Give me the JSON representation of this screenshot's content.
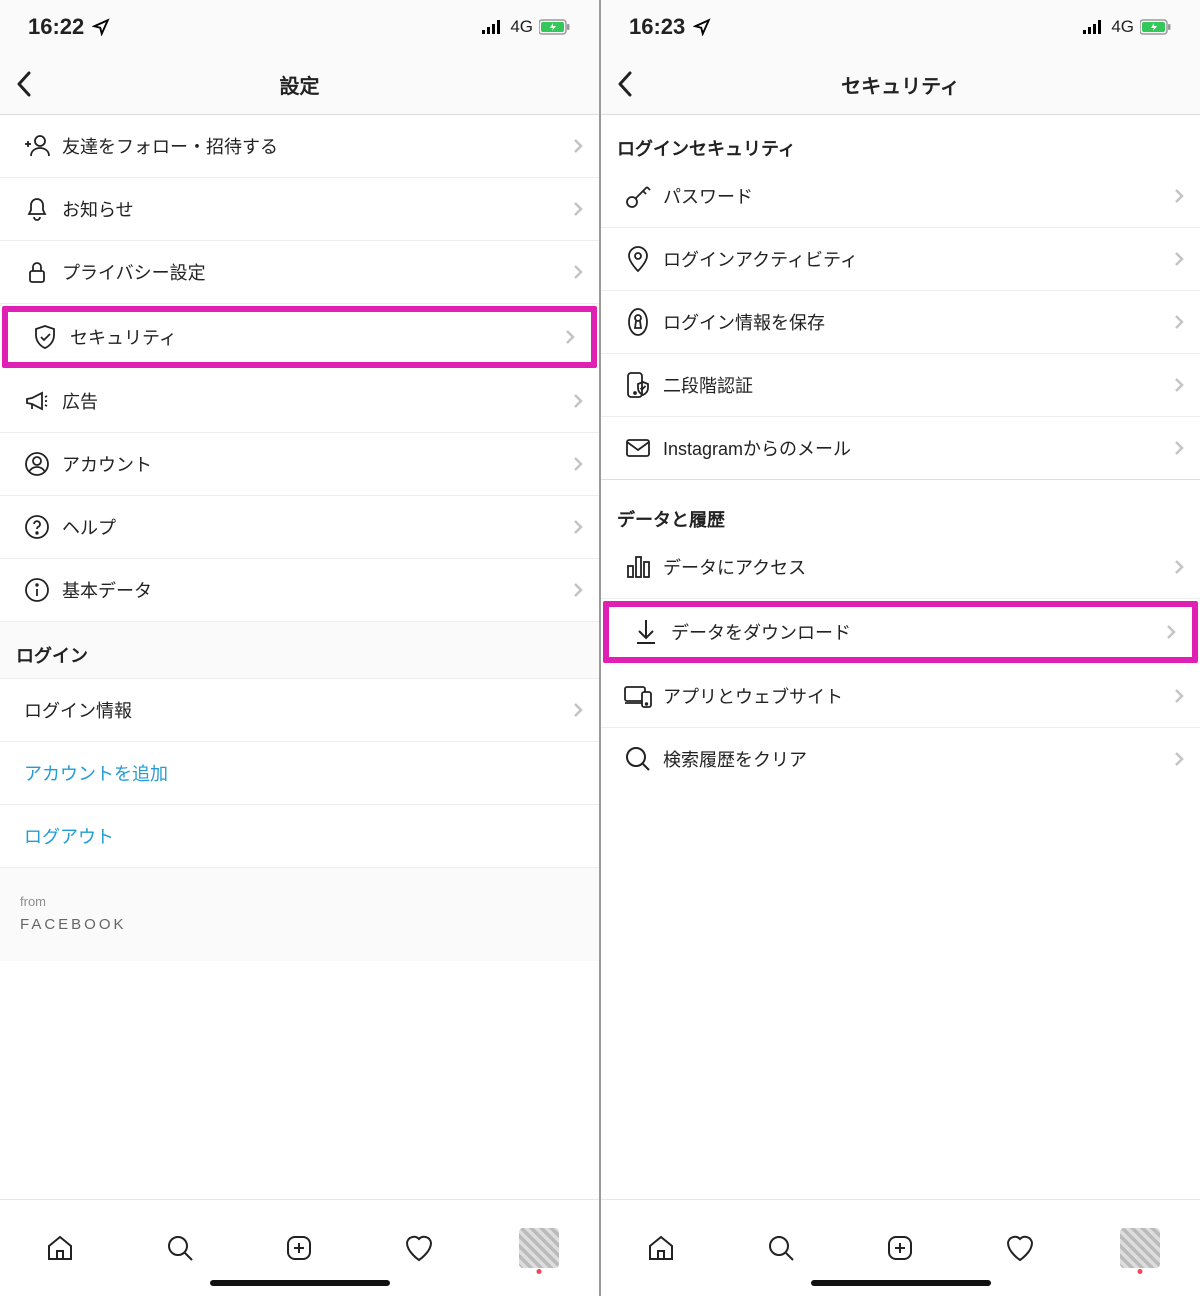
{
  "left": {
    "status": {
      "time": "16:22",
      "network": "4G"
    },
    "headerTitle": "設定",
    "items": [
      {
        "label": "友達をフォロー・招待する"
      },
      {
        "label": "お知らせ"
      },
      {
        "label": "プライバシー設定"
      },
      {
        "label": "セキュリティ"
      },
      {
        "label": "広告"
      },
      {
        "label": "アカウント"
      },
      {
        "label": "ヘルプ"
      },
      {
        "label": "基本データ"
      }
    ],
    "loginSection": "ログイン",
    "loginInfo": "ログイン情報",
    "addAccount": "アカウントを追加",
    "logout": "ログアウト",
    "from": "from",
    "facebook": "FACEBOOK"
  },
  "right": {
    "status": {
      "time": "16:23",
      "network": "4G"
    },
    "headerTitle": "セキュリティ",
    "section1": "ログインセキュリティ",
    "items1": [
      {
        "label": "パスワード"
      },
      {
        "label": "ログインアクティビティ"
      },
      {
        "label": "ログイン情報を保存"
      },
      {
        "label": "二段階認証"
      },
      {
        "label": "Instagramからのメール"
      }
    ],
    "section2": "データと履歴",
    "items2": [
      {
        "label": "データにアクセス"
      },
      {
        "label": "データをダウンロード"
      },
      {
        "label": "アプリとウェブサイト"
      },
      {
        "label": "検索履歴をクリア"
      }
    ]
  }
}
